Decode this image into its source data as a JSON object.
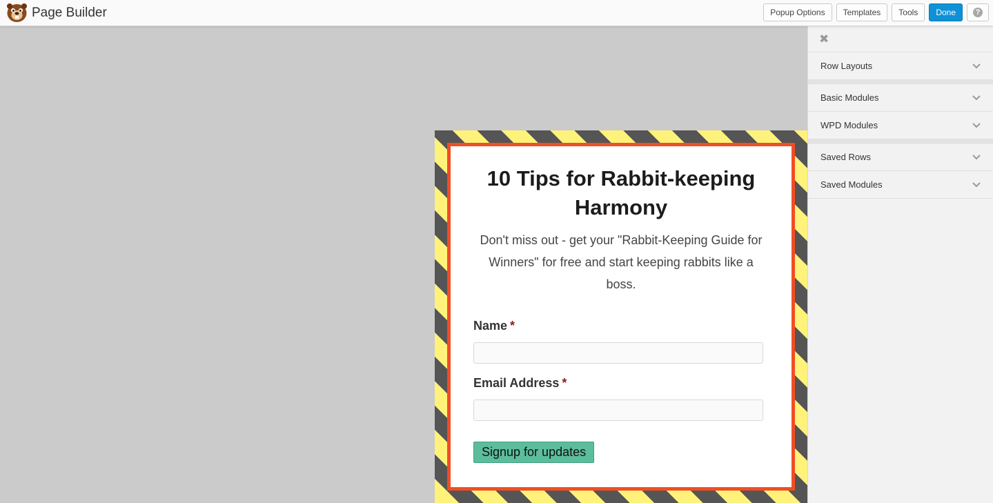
{
  "app": {
    "title": "Page Builder",
    "logo_icon": "beaver-logo-icon"
  },
  "toolbar": {
    "popup_options_label": "Popup Options",
    "templates_label": "Templates",
    "tools_label": "Tools",
    "done_label": "Done",
    "help_glyph": "?"
  },
  "panel": {
    "close_glyph": "✖",
    "sections": [
      {
        "label": "Row Layouts"
      },
      {
        "label": "Basic Modules"
      },
      {
        "label": "WPD Modules"
      },
      {
        "label": "Saved Rows"
      },
      {
        "label": "Saved Modules"
      }
    ]
  },
  "popup": {
    "title": "10 Tips for Rabbit-keeping Harmony",
    "description": "Don't miss out - get your \"Rabbit-Keeping Guide for Winners\" for free and start keeping rabbits like a boss.",
    "fields": [
      {
        "label": "Name",
        "required_mark": "*",
        "value": ""
      },
      {
        "label": "Email Address",
        "required_mark": "*",
        "value": ""
      }
    ],
    "submit_label": "Signup for updates"
  },
  "colors": {
    "accent": "#0e91d6",
    "popup_border": "#f04e23",
    "stripe_yellow": "#fff27a",
    "stripe_dark": "#555555",
    "submit_bg": "#5bbd9c"
  }
}
